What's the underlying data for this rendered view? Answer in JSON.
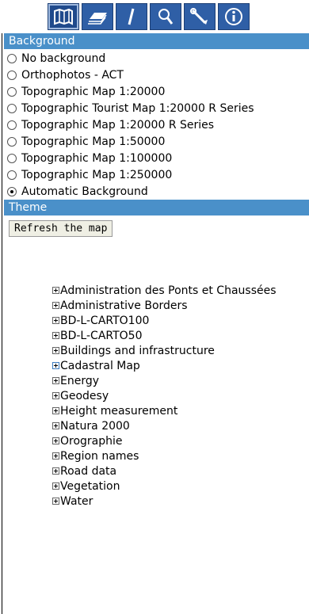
{
  "toolbar": {
    "buttons": [
      {
        "name": "map-icon",
        "active": true
      },
      {
        "name": "layers-icon",
        "active": false
      },
      {
        "name": "measure-icon",
        "active": false
      },
      {
        "name": "search-icon",
        "active": false
      },
      {
        "name": "tools-icon",
        "active": false
      },
      {
        "name": "info-icon",
        "active": false
      }
    ]
  },
  "background": {
    "header": "Background",
    "options": [
      {
        "label": "No background",
        "checked": false
      },
      {
        "label": "Orthophotos - ACT",
        "checked": false
      },
      {
        "label": "Topographic Map 1:20000",
        "checked": false
      },
      {
        "label": "Topographic Tourist Map 1:20000 R Series",
        "checked": false
      },
      {
        "label": "Topographic Map 1:20000 R Series",
        "checked": false
      },
      {
        "label": "Topographic Map 1:50000",
        "checked": false
      },
      {
        "label": "Topographic Map 1:100000",
        "checked": false
      },
      {
        "label": "Topographic Map 1:250000",
        "checked": false
      },
      {
        "label": "Automatic Background",
        "checked": true
      }
    ]
  },
  "theme": {
    "header": "Theme",
    "refresh_label": "Refresh the map",
    "items": [
      "Administration des Ponts et Chaussées",
      "Administrative Borders",
      "BD-L-CARTO100",
      "BD-L-CARTO50",
      "Buildings and infrastructure",
      "Cadastral Map",
      "Energy",
      "Geodesy",
      "Height measurement",
      "Natura 2000",
      "Orographie",
      "Region names",
      "Road data",
      "Vegetation",
      "Water"
    ]
  },
  "colors": {
    "header_bg": "#4a90c9",
    "toolbar_bg": "#2f5fa6"
  }
}
